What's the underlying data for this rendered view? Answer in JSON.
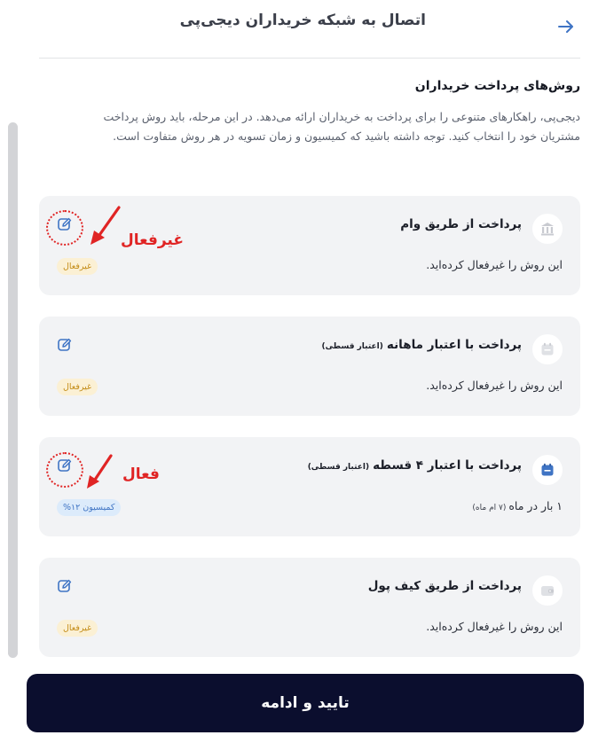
{
  "header": {
    "title": "اتصال به شبکه خریداران دیجی‌پی",
    "back_icon": "arrow-right-icon"
  },
  "section": {
    "title": "روش‌های پرداخت خریداران",
    "description": "دیجی‌پی، راهکارهای متنوعی را برای پرداخت به خریداران ارائه می‌دهد. در این مرحله، باید روش پرداخت مشتریان خود را انتخاب کنید. توجه داشته باشید که کمیسیون و زمان تسویه در هر روش متفاوت است."
  },
  "methods": [
    {
      "title": "پرداخت از طریق وام",
      "subtitle": "",
      "description": "این روش را غیرفعال کرده‌اید.",
      "description_sub": "",
      "badge": "غیرفعال",
      "status": "inactive",
      "icon": "bank-icon"
    },
    {
      "title": "پرداخت با اعتبار ماهانه",
      "subtitle": "(اعتبار قسطی)",
      "description": "این روش را غیرفعال کرده‌اید.",
      "description_sub": "",
      "badge": "غیرفعال",
      "status": "inactive",
      "icon": "calendar-icon"
    },
    {
      "title": "پرداخت با اعتبار ۴ قسطه",
      "subtitle": "(اعتبار قسطی)",
      "description": "۱ بار در ماه",
      "description_sub": "(۷ ام ماه)",
      "badge": "کمیسیون ۱۲%",
      "status": "active",
      "icon": "calendar-icon"
    },
    {
      "title": "پرداخت از طریق کیف پول",
      "subtitle": "",
      "description": "این روش را غیرفعال کرده‌اید.",
      "description_sub": "",
      "badge": "غیرفعال",
      "status": "inactive",
      "icon": "wallet-icon"
    }
  ],
  "annotations": {
    "inactive_label": "غیرفعال",
    "active_label": "فعال"
  },
  "cta": {
    "label": "تایید و ادامه"
  },
  "colors": {
    "primary_dark": "#0b0e2e",
    "accent_blue": "#3f74c4",
    "inactive_badge_bg": "#fbf0d4",
    "inactive_badge_text": "#c38b15",
    "active_badge_bg": "#dcebfb",
    "annotation_red": "#e02424",
    "card_bg": "#f2f3f5"
  }
}
